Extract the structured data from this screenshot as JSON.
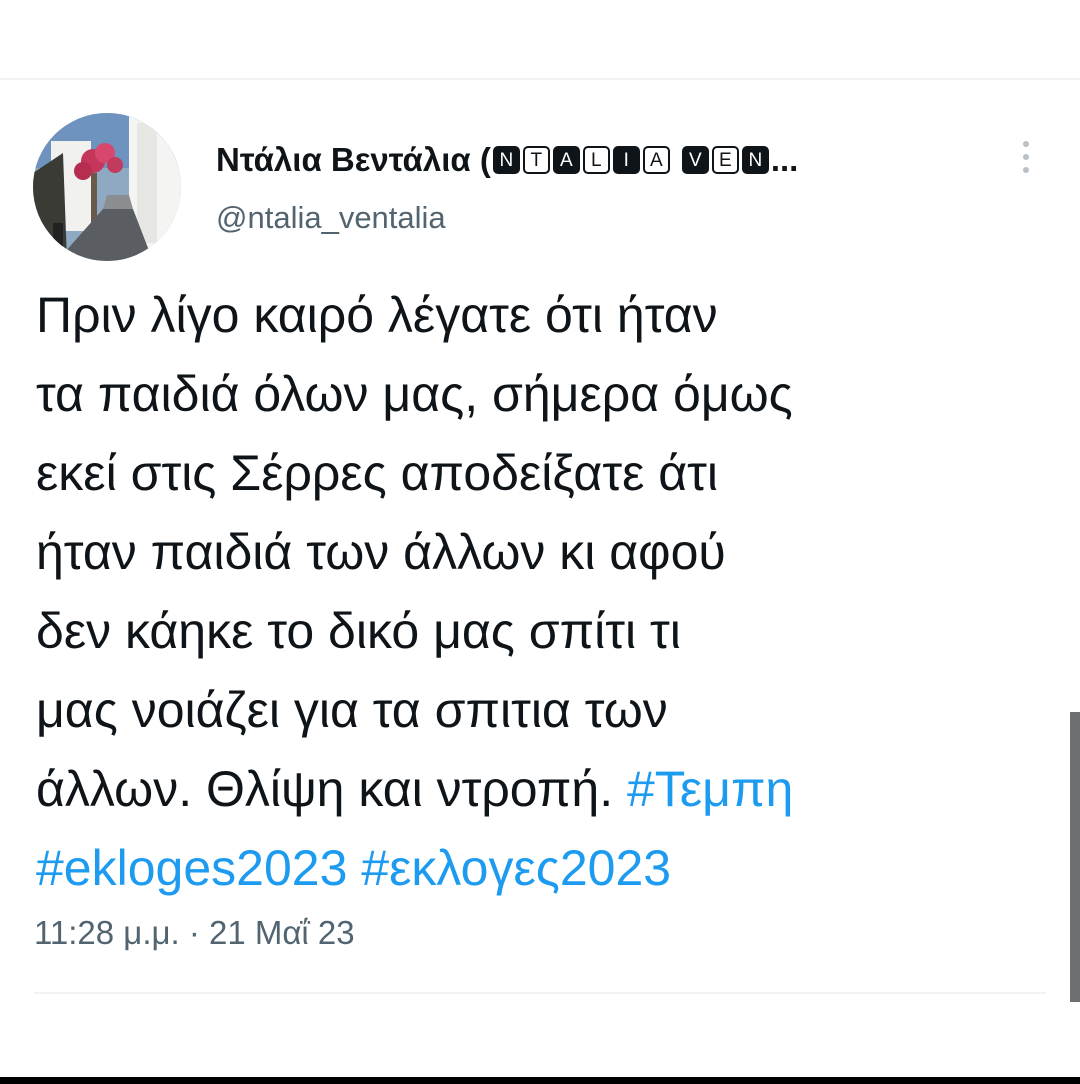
{
  "tweet": {
    "author": {
      "name_prefix": "Ντάλια Βεντάλια (",
      "name_badges": [
        [
          {
            "char": "N",
            "style": "dark"
          },
          {
            "char": "T",
            "style": "light"
          },
          {
            "char": "A",
            "style": "dark"
          },
          {
            "char": "L",
            "style": "light"
          },
          {
            "char": "I",
            "style": "dark"
          },
          {
            "char": "A",
            "style": "light"
          }
        ],
        [
          {
            "char": "V",
            "style": "dark"
          },
          {
            "char": "E",
            "style": "light"
          },
          {
            "char": "N",
            "style": "dark"
          }
        ]
      ],
      "name_ellipsis": "...",
      "handle": "@ntalia_ventalia",
      "avatar_icon": "avatar-photo-village-street"
    },
    "menu_icon": "more-vertical-icon",
    "text_lines": [
      [
        {
          "text": "Πριν λίγο καιρό λέγατε ότι ήταν",
          "type": "text"
        }
      ],
      [
        {
          "text": "τα παιδιά όλων μας, σήμερα όμως",
          "type": "text"
        }
      ],
      [
        {
          "text": "εκεί στις Σέρρες αποδείξατε άτι",
          "type": "text"
        }
      ],
      [
        {
          "text": "ήταν παιδιά των άλλων κι αφού",
          "type": "text"
        }
      ],
      [
        {
          "text": "δεν κάηκε το δικό μας σπίτι τι",
          "type": "text"
        }
      ],
      [
        {
          "text": "μας νοιάζει για τα σπιτια των",
          "type": "text"
        }
      ],
      [
        {
          "text": "άλλων. Θλίψη και ντροπή. ",
          "type": "text"
        },
        {
          "text": "#Τεμπη",
          "type": "hashtag"
        }
      ],
      [
        {
          "text": "#ekloges2023",
          "type": "hashtag"
        },
        {
          "text": " ",
          "type": "text"
        },
        {
          "text": "#εκλογες2023",
          "type": "hashtag"
        }
      ]
    ],
    "timestamp": "11:28 μ.μ. · 21 Μαΐ 23"
  },
  "colors": {
    "text_primary": "#0f1419",
    "text_secondary": "#536471",
    "hashtag": "#1d9bf0",
    "divider": "#eff1f3"
  }
}
